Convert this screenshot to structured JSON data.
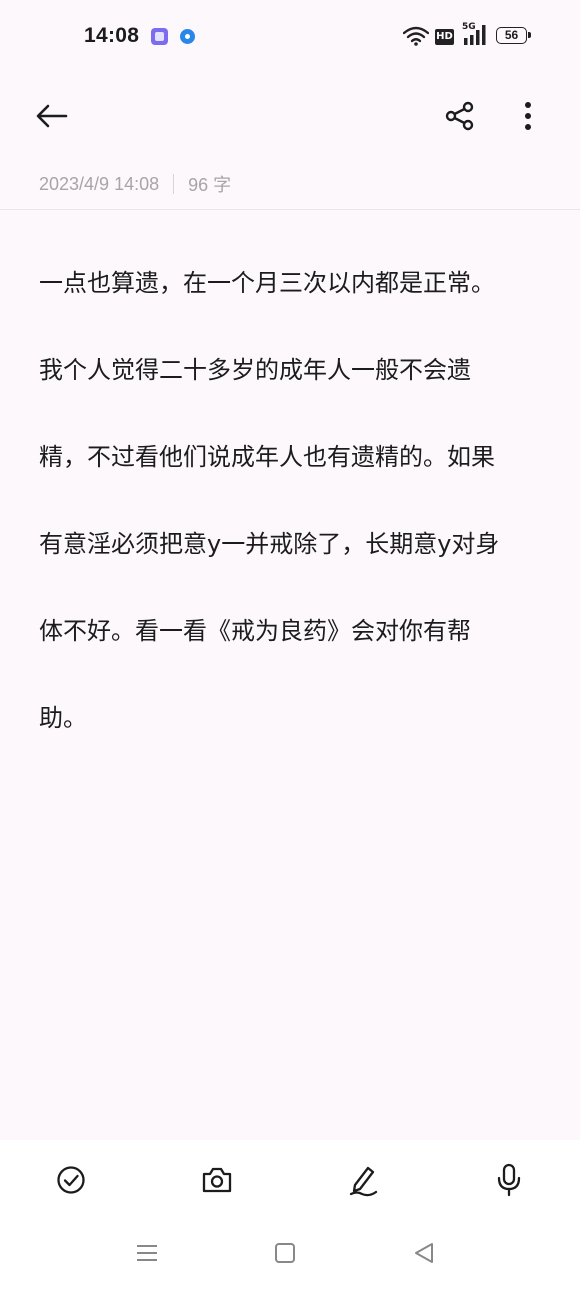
{
  "status_bar": {
    "time": "14:08",
    "notification_icons": [
      "clipboard-app-icon",
      "blue-dot-app-icon"
    ],
    "hd_label": "HD",
    "network_label": "5G",
    "battery": "56"
  },
  "header": {
    "back_icon": "arrow-left-icon",
    "share_icon": "share-icon",
    "more_icon": "more-vertical-icon"
  },
  "note": {
    "date": "2023/4/9 14:08",
    "char_count": "96 字",
    "lines": [
      "一点也算遗，在一个月三次以内都是正常。",
      "我个人觉得二十多岁的成年人一般不会遗",
      "精，不过看他们说成年人也有遗精的。如果",
      "有意淫必须把意y一并戒除了，长期意y对身",
      "体不好。看一看《戒为良药》会对你有帮",
      "助。"
    ]
  },
  "toolbar": {
    "icons": [
      "checklist-icon",
      "camera-icon",
      "handwriting-icon",
      "microphone-icon"
    ]
  },
  "nav": {
    "icons": [
      "recent-apps-icon",
      "home-icon",
      "back-icon"
    ]
  },
  "colors": {
    "background": "#fcf8fc",
    "text": "#1c1c1c",
    "meta_text": "#a8a4a8",
    "toolbar_bg": "#ffffff"
  }
}
